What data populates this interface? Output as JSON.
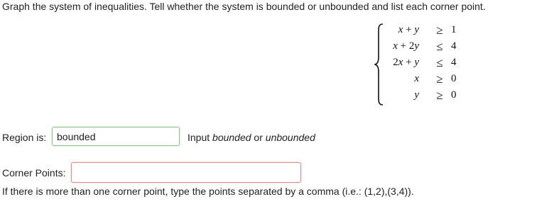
{
  "question": {
    "text": "Graph the system of inequalities. Tell whether the system is bounded or unbounded and list each corner point."
  },
  "system": {
    "inequalities": [
      {
        "lhs_parts": [
          "x",
          " + ",
          "y"
        ],
        "relation": "≥",
        "rhs": "1"
      },
      {
        "lhs_parts": [
          "x",
          " + 2",
          "y"
        ],
        "relation": "≤",
        "rhs": "4"
      },
      {
        "lhs_parts": [
          "2",
          "x",
          " + ",
          "y"
        ],
        "relation": "≤",
        "rhs": "4"
      },
      {
        "lhs_parts": [
          "x"
        ],
        "relation": "≥",
        "rhs": "0"
      },
      {
        "lhs_parts": [
          "y"
        ],
        "relation": "≥",
        "rhs": "0"
      }
    ]
  },
  "region": {
    "label": "Region is:",
    "value": "bounded",
    "hint_prefix": "Input ",
    "hint_option1": "bounded",
    "hint_or": " or ",
    "hint_option2": "unbounded",
    "status_color": "#8cc88c"
  },
  "corner_points": {
    "label": "Corner Points:",
    "value": "",
    "hint": "If there is more than one corner point, type the points separated by a comma (i.e.: (1,2),(3,4)).",
    "status_color": "#e08a8a"
  }
}
